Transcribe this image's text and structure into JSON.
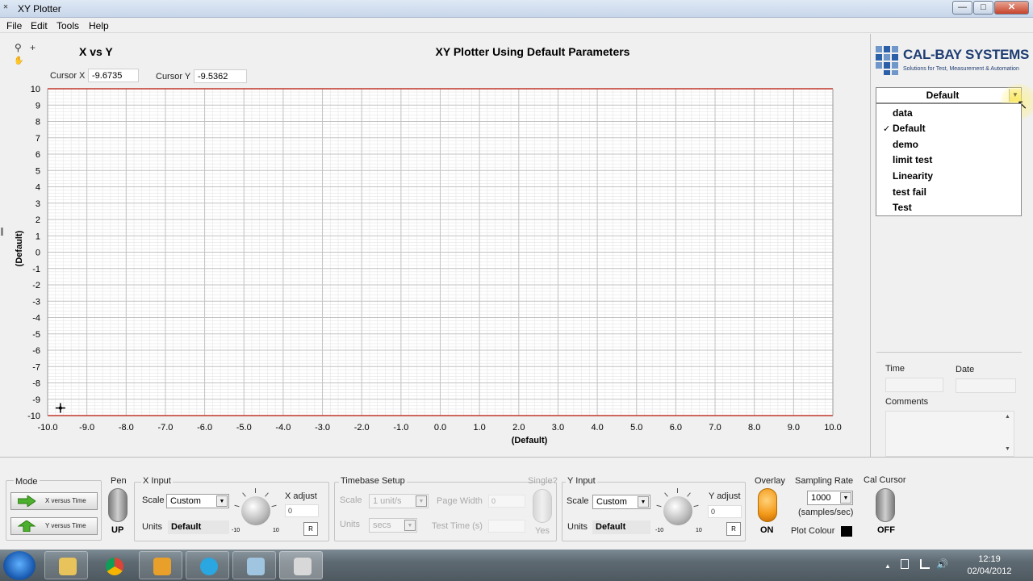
{
  "window": {
    "app_icon": "xy-plotter-icon",
    "title": "XY Plotter",
    "minimize": "—",
    "maximize": "□",
    "close": "✕"
  },
  "menu": [
    "File",
    "Edit",
    "Tools",
    "Help"
  ],
  "toolbar": {
    "zoom_icon": "zoom-icon",
    "cursor_icon": "crosshair-icon",
    "pan_icon": "hand-icon",
    "zoom_glyph": "⚲",
    "plus_glyph": "+",
    "hand_glyph": "✋"
  },
  "graph": {
    "title": "X vs Y",
    "chart_title": "XY Plotter Using Default Parameters",
    "cursor_x_label": "Cursor X",
    "cursor_x_value": "-9.6735",
    "cursor_y_label": "Cursor Y",
    "cursor_y_value": "-9.5362"
  },
  "chart_data": {
    "type": "scatter",
    "title": "XY Plotter Using Default Parameters",
    "xlabel": "(Default)",
    "ylabel": "(Default)",
    "xlim": [
      -10,
      10
    ],
    "ylim": [
      -10,
      10
    ],
    "x_ticks": [
      "-10.0",
      "-9.0",
      "-8.0",
      "-7.0",
      "-6.0",
      "-5.0",
      "-4.0",
      "-3.0",
      "-2.0",
      "-1.0",
      "0.0",
      "1.0",
      "2.0",
      "3.0",
      "4.0",
      "5.0",
      "6.0",
      "7.0",
      "8.0",
      "9.0",
      "10.0"
    ],
    "y_ticks": [
      "10",
      "9",
      "8",
      "7",
      "6",
      "5",
      "4",
      "3",
      "2",
      "1",
      "0",
      "-1",
      "-2",
      "-3",
      "-4",
      "-5",
      "-6",
      "-7",
      "-8",
      "-9",
      "-10"
    ],
    "grid": true,
    "series": [],
    "cursor": {
      "x": -9.6735,
      "y": -9.5362
    }
  },
  "brand": {
    "name": "CAL-BAY SYSTEMS",
    "tagline": "Solutions for Test, Measurement & Automation",
    "color": "#1f3d73"
  },
  "config_dropdown": {
    "selected": "Default",
    "options": [
      "data",
      "Default",
      "demo",
      "limit test",
      "Linearity",
      "test fail",
      "Test"
    ],
    "check_mark": "✓"
  },
  "info": {
    "time_label": "Time",
    "date_label": "Date",
    "comments_label": "Comments",
    "scroll_up": "▲",
    "scroll_down": "▼"
  },
  "mode": {
    "label": "Mode",
    "x_button": "X versus Time",
    "y_button": "Y versus Time"
  },
  "pen": {
    "label": "Pen",
    "state": "UP"
  },
  "x_input": {
    "label": "X Input",
    "scale_label": "Scale",
    "scale_value": "Custom",
    "units_label": "Units",
    "units_value": "Default",
    "knob_min": "-10",
    "knob_max": "10",
    "adjust_label": "X adjust",
    "adjust_value": "0",
    "reset": "R"
  },
  "timebase": {
    "label": "Timebase Setup",
    "scale_label": "Scale",
    "scale_value": "1 unit/s",
    "page_width_label": "Page Width",
    "page_width_value": "0",
    "units_label": "Units",
    "units_value": "secs",
    "test_time_label": "Test Time (s)",
    "single_label": "Single?",
    "single_state": "Yes"
  },
  "y_input": {
    "label": "Y Input",
    "scale_label": "Scale",
    "scale_value": "Custom",
    "units_label": "Units",
    "units_value": "Default",
    "knob_min": "-10",
    "knob_max": "10",
    "adjust_label": "Y adjust",
    "adjust_value": "0",
    "reset": "R"
  },
  "overlay": {
    "label": "Overlay",
    "state": "ON"
  },
  "sampling": {
    "label": "Sampling Rate",
    "value": "1000",
    "unit": "(samples/sec)",
    "plot_colour_label": "Plot Colour",
    "plot_colour": "#000000"
  },
  "cal_cursor": {
    "label": "Cal Cursor",
    "state": "OFF"
  },
  "taskbar": {
    "apps": [
      "windows-explorer",
      "google-chrome",
      "microsoft-outlook",
      "skype",
      "application",
      "xy-plotter"
    ],
    "tray_up": "▲",
    "tray_volume": "🔊",
    "time": "12:19",
    "date": "02/04/2012"
  },
  "colors": {
    "plot_axis": "#c0392b",
    "plot_bg": "#ffffff",
    "grid_major": "#c2c2c2",
    "grid_minor": "#e6e6e6"
  }
}
